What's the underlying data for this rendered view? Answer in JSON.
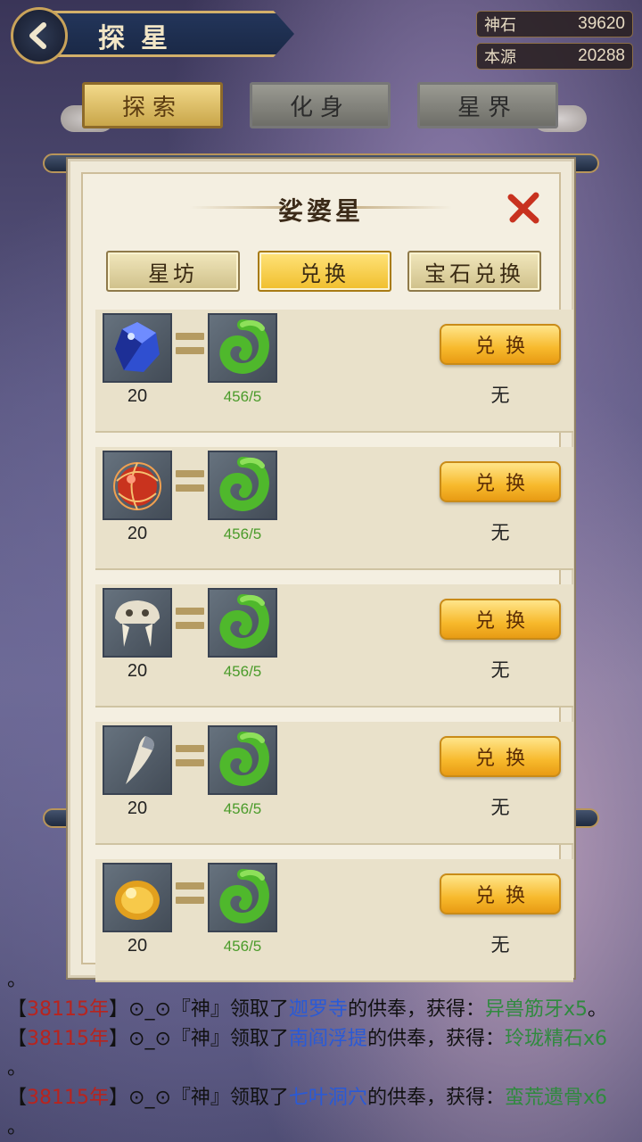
{
  "header": {
    "title": "探星",
    "resources": [
      {
        "label": "神石",
        "value": "39620"
      },
      {
        "label": "本源",
        "value": "20288"
      }
    ]
  },
  "top_tabs": [
    {
      "label": "探索",
      "active": true
    },
    {
      "label": "化身",
      "active": false
    },
    {
      "label": "星界",
      "active": false
    }
  ],
  "panel": {
    "title": "娑婆星",
    "sub_tabs": [
      {
        "label": "星坊",
        "active": false
      },
      {
        "label": "兑换",
        "active": true
      },
      {
        "label": "宝石兑换",
        "active": false
      }
    ],
    "rows": [
      {
        "item_icon": "blue-gem-icon",
        "quantity": "20",
        "reward_icon": "green-jade-dragon-icon",
        "requirement": "456/5",
        "button_label": "兑换",
        "status": "无"
      },
      {
        "item_icon": "red-orb-icon",
        "quantity": "20",
        "reward_icon": "green-jade-dragon-icon",
        "requirement": "456/5",
        "button_label": "兑换",
        "status": "无"
      },
      {
        "item_icon": "beast-skull-icon",
        "quantity": "20",
        "reward_icon": "green-jade-dragon-icon",
        "requirement": "456/5",
        "button_label": "兑换",
        "status": "无"
      },
      {
        "item_icon": "beast-fang-icon",
        "quantity": "20",
        "reward_icon": "green-jade-dragon-icon",
        "requirement": "456/5",
        "button_label": "兑换",
        "status": "无"
      },
      {
        "item_icon": "golden-orb-icon",
        "quantity": "20",
        "reward_icon": "green-jade-dragon-icon",
        "requirement": "456/5",
        "button_label": "兑换",
        "status": "无"
      }
    ]
  },
  "chat": {
    "messages": [
      {
        "year": "38115年",
        "player": "⊙_⊙『神』",
        "verb": "领取了",
        "place": "迦罗寺",
        "mid": "的供奉，获得：",
        "item": "异兽筋牙x5",
        "tail": "。"
      },
      {
        "year": "38115年",
        "player": "⊙_⊙『神』",
        "verb": "领取了",
        "place": "南阎浮提",
        "mid": "的供奉，获得：",
        "item": "玲珑精石x6",
        "tail": "。"
      },
      {
        "year": "38115年",
        "player": "⊙_⊙『神』",
        "verb": "领取了",
        "place": "七叶洞穴",
        "mid": "的供奉，获得：",
        "item": "蛮荒遗骨x6",
        "tail": "。"
      }
    ],
    "top_fragment": "。"
  }
}
